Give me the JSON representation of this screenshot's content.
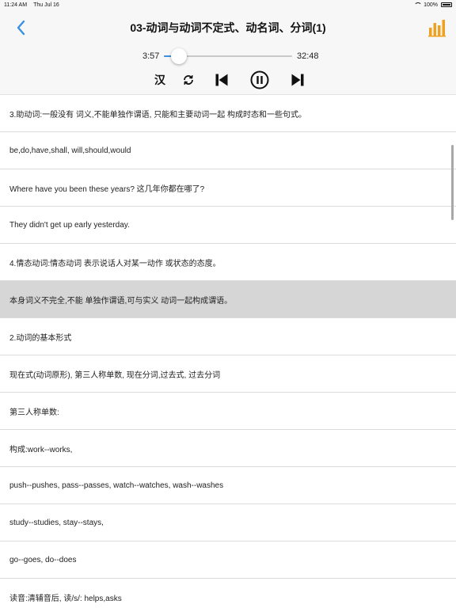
{
  "status_bar": {
    "time": "11:24 AM",
    "date": "Thu Jul 16",
    "battery": "100%"
  },
  "nav": {
    "title": "03-动词与动词不定式、动名词、分词(1)",
    "accent_color": "#3a8fe0",
    "chart_color": "#f0a020"
  },
  "player": {
    "current_time": "3:57",
    "total_time": "32:48",
    "progress": 0.12,
    "han_label": "汉"
  },
  "rows": [
    "3.助动词:一般没有 词义,不能单独作谓语, 只能和主要动词一起 构成时态和一些句式。",
    "be,do,have,shall, will,should,would",
    "Where have you been these years? 这几年你都在哪了?",
    "They didn't get up early yesterday.",
    "4.情态动词:情态动词 表示说话人对某一动作 或状态的态度。",
    "本身词义不完全,不能 单独作谓语,可与实义 动词一起构成谓语。",
    "2.动词的基本形式",
    "现在式(动词原形), 第三人称单数, 现在分词,过去式, 过去分词",
    "第三人称单数:",
    "构成:work--works,",
    "push--pushes, pass--passes, watch--watches, wash--washes",
    "study--studies, stay--stays,",
    "go--goes, do--does",
    "读音:清辅音后, 读/s/: helps,asks"
  ],
  "active_row": 5
}
